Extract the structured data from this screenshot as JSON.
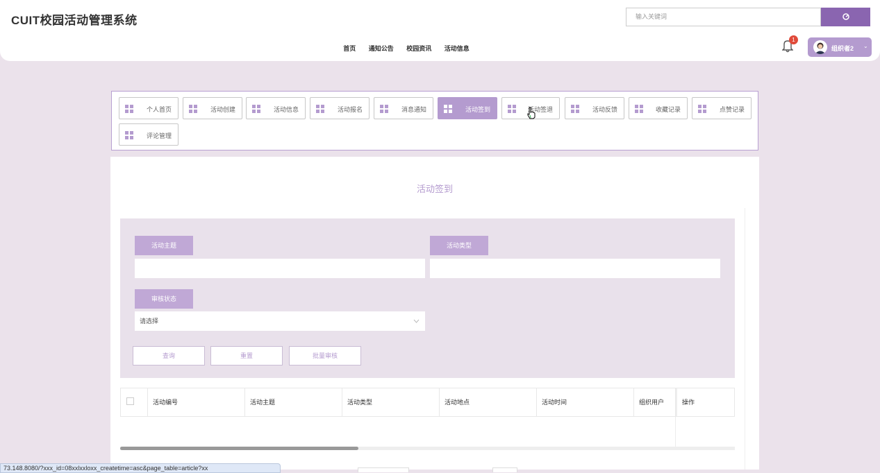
{
  "header": {
    "logo": "CUIT校园活动管理系统",
    "search_placeholder": "输入关键词",
    "nav": [
      "首页",
      "通知公告",
      "校园资讯",
      "活动信息"
    ],
    "notification_count": "1",
    "user_name": "组织者2"
  },
  "menu": [
    {
      "label": "个人首页",
      "active": false
    },
    {
      "label": "活动创建",
      "active": false
    },
    {
      "label": "活动信息",
      "active": false
    },
    {
      "label": "活动报名",
      "active": false
    },
    {
      "label": "消息通知",
      "active": false
    },
    {
      "label": "活动签到",
      "active": true
    },
    {
      "label": "活动签退",
      "active": false
    },
    {
      "label": "活动反馈",
      "active": false
    },
    {
      "label": "收藏记录",
      "active": false
    },
    {
      "label": "点赞记录",
      "active": false
    },
    {
      "label": "评论管理",
      "active": false
    }
  ],
  "page_title": "活动签到",
  "filters": {
    "subject_label": "活动主题",
    "subject_value": "",
    "type_label": "活动类型",
    "type_value": "",
    "status_label": "审核状态",
    "status_value": "请选择"
  },
  "buttons": {
    "query": "查询",
    "reset": "重置",
    "batch_review": "批量审核"
  },
  "table": {
    "columns": [
      "活动编号",
      "活动主题",
      "活动类型",
      "活动地点",
      "活动时间",
      "组织用户",
      "操作"
    ]
  },
  "status_bar_url": "73.148.8080/?xxx_id=08xxlxxloxx_createtime=asc&page_table=article?xx",
  "colors": {
    "accent": "#8a65b0",
    "accent_light": "#b49bcf",
    "background": "#ebe2eb"
  }
}
